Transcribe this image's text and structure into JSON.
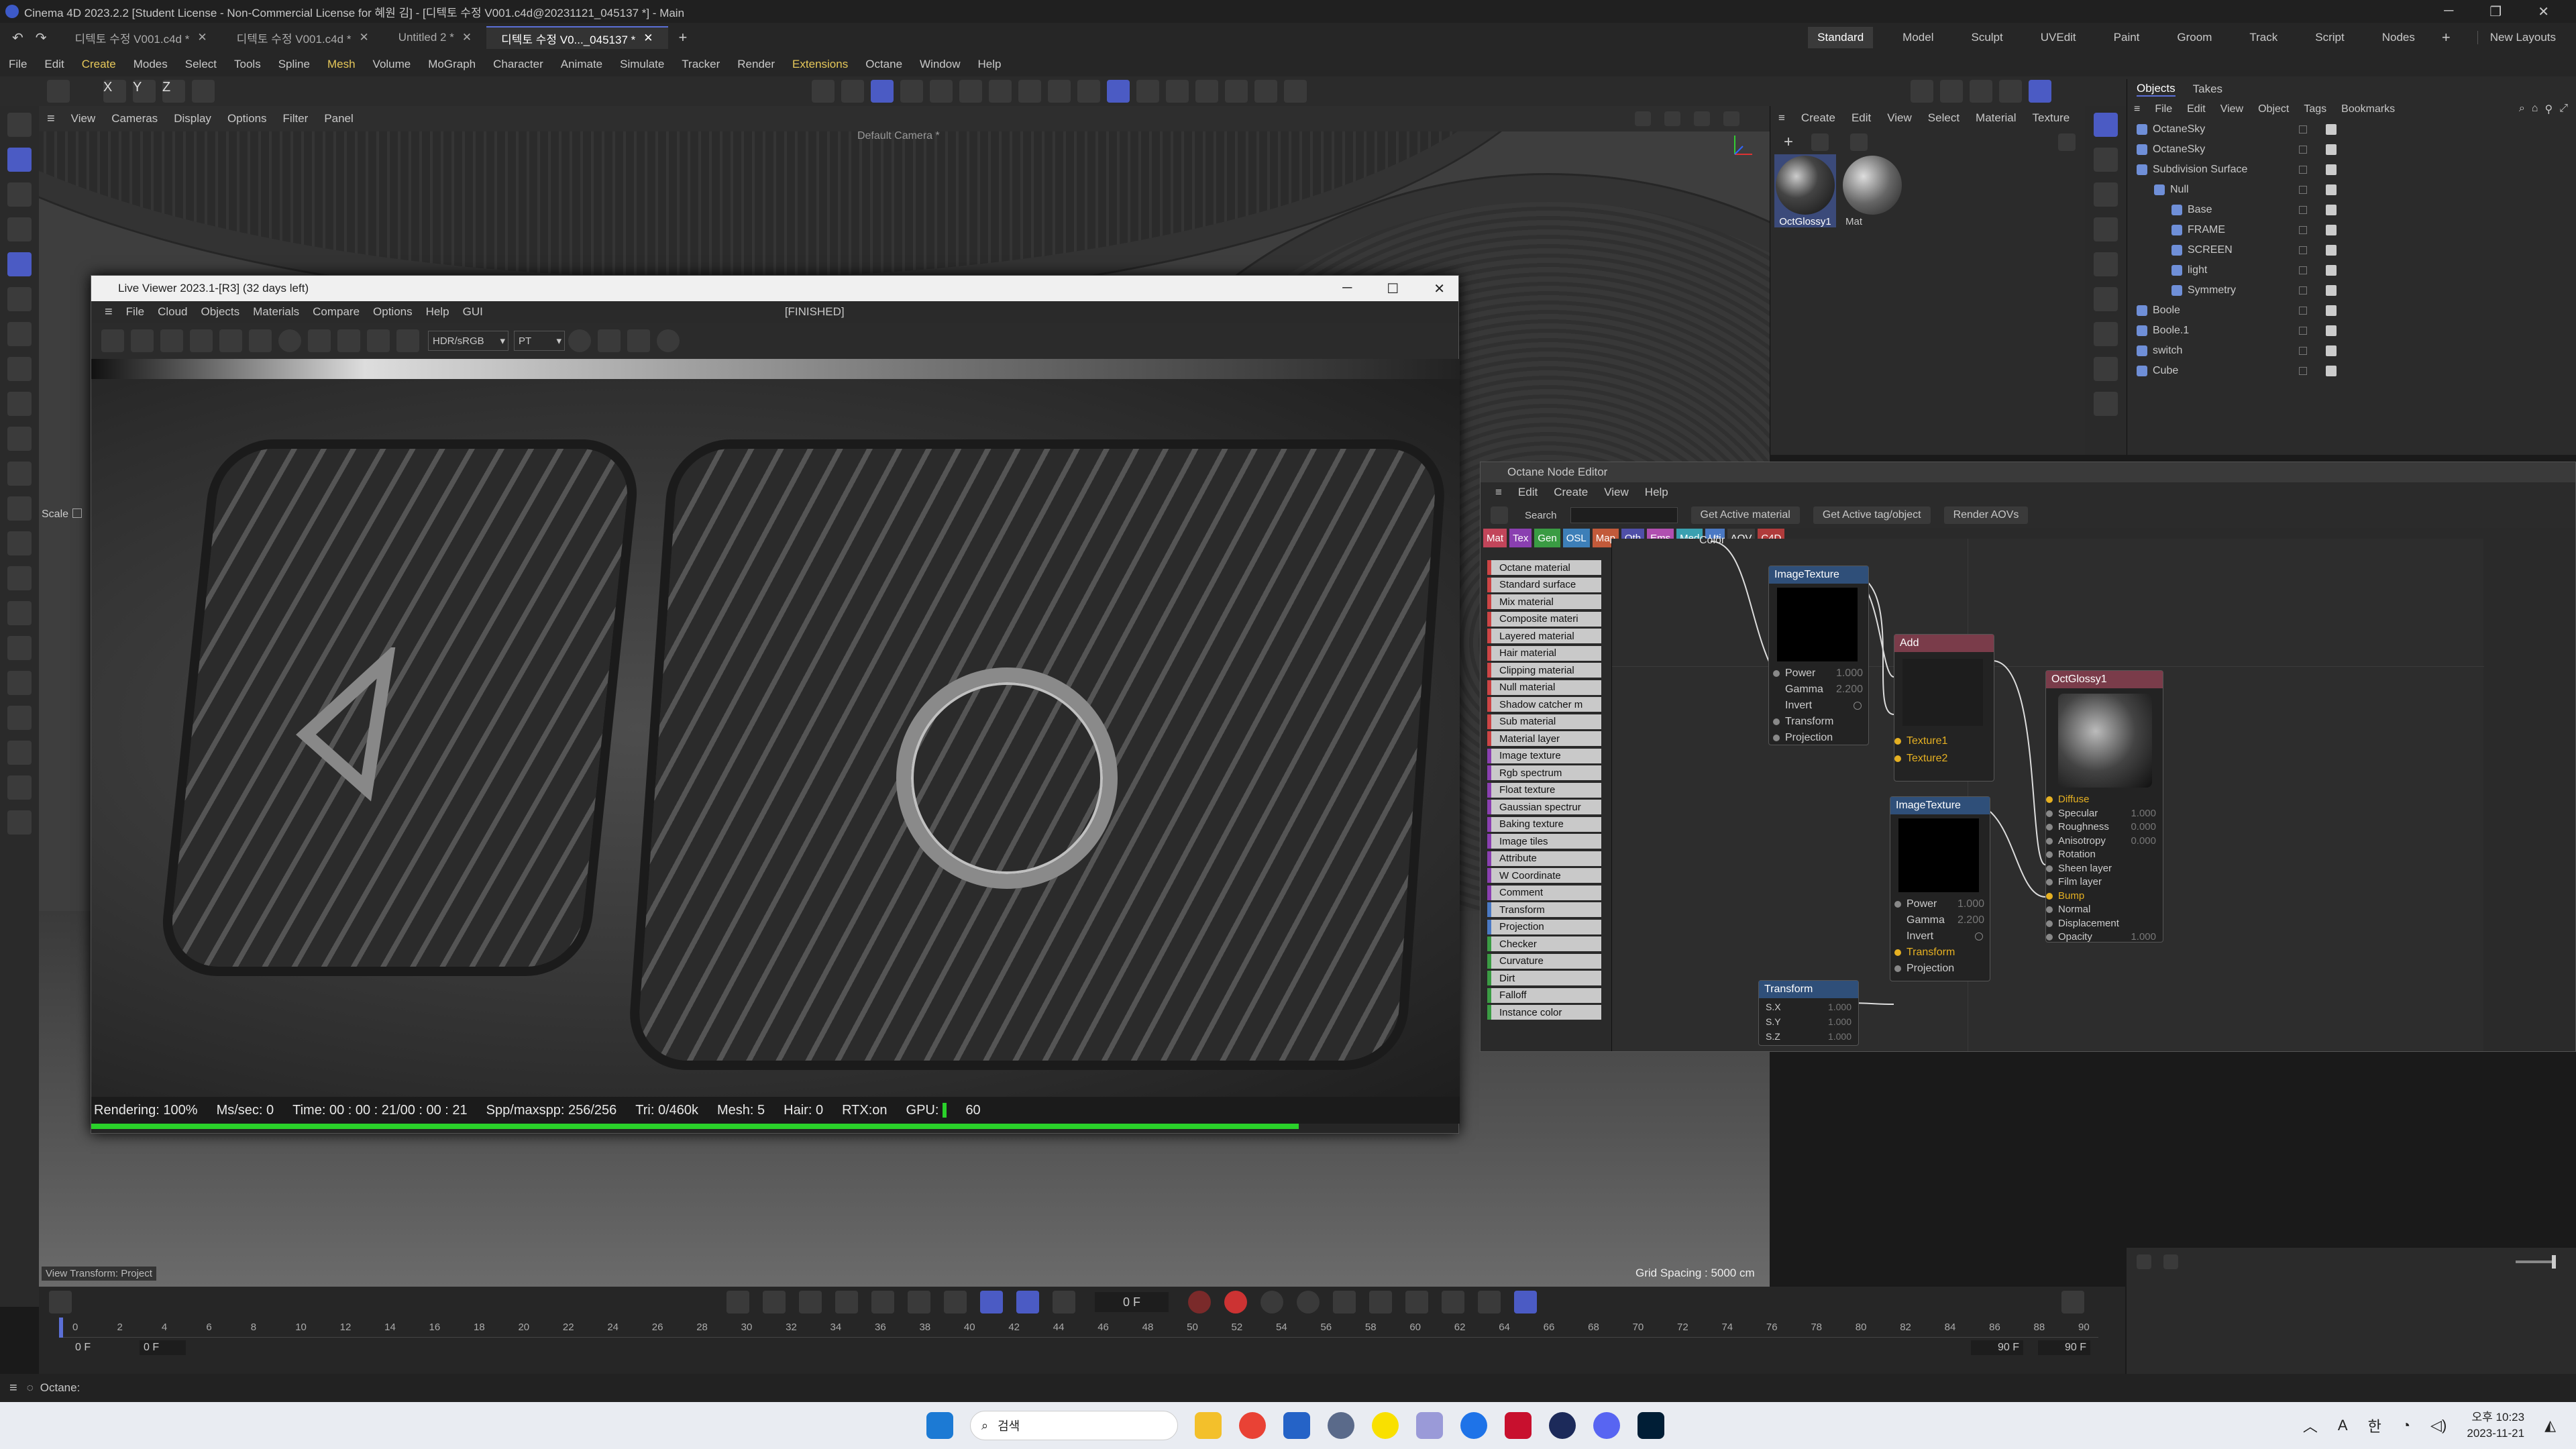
{
  "app": {
    "title": "Cinema 4D 2023.2.2 [Student License - Non-Commercial License for 혜원 김] - [디텍토 수정 V001.c4d@20231121_045137 *] - Main",
    "layouts": [
      "Standard",
      "Model",
      "Sculpt",
      "UVEdit",
      "Paint",
      "Groom",
      "Track",
      "Script",
      "Nodes"
    ],
    "new_layouts": "New Layouts"
  },
  "doc_tabs": [
    "디텍토 수정 V001.c4d *",
    "디텍토 수정 V001.c4d *",
    "Untitled 2 *",
    "디텍토 수정 V0..._045137 *"
  ],
  "menu": [
    "File",
    "Edit",
    "Create",
    "Modes",
    "Select",
    "Tools",
    "Spline",
    "Mesh",
    "Volume",
    "MoGraph",
    "Character",
    "Animate",
    "Simulate",
    "Tracker",
    "Render",
    "Extensions",
    "Octane",
    "Window",
    "Help"
  ],
  "axis": [
    "X",
    "Y",
    "Z"
  ],
  "viewport": {
    "menu": [
      "View",
      "Cameras",
      "Display",
      "Options",
      "Filter",
      "Panel"
    ],
    "camera": "Default Camera *",
    "scale_label": "Scale",
    "view_transform": "View Transform: Project",
    "grid_spacing": "Grid Spacing : 5000 cm"
  },
  "live_viewer": {
    "title": "Live Viewer 2023.1-[R3] (32 days left)",
    "menu": [
      "File",
      "Cloud",
      "Objects",
      "Materials",
      "Compare",
      "Options",
      "Help",
      "GUI"
    ],
    "state": "[FINISHED]",
    "color_mode": "HDR/sRGB",
    "kernel": "PT",
    "status": {
      "rendering": "Rendering: 100%",
      "ms": "Ms/sec: 0",
      "time": "Time: 00 : 00 : 21/00 : 00 : 21",
      "spp": "Spp/maxspp: 256/256",
      "tri": "Tri: 0/460k",
      "mesh": "Mesh: 5",
      "hair": "Hair: 0",
      "rtx": "RTX:on",
      "gpu": "GPU:",
      "gpu_val": "60"
    },
    "progress": 1.0
  },
  "material_panel": {
    "menu": [
      "Create",
      "Edit",
      "View",
      "Select",
      "Material",
      "Texture"
    ],
    "materials": [
      "OctGlossy1",
      "Mat"
    ]
  },
  "objects_panel": {
    "tabs": [
      "Objects",
      "Takes"
    ],
    "menu": [
      "File",
      "Edit",
      "View",
      "Object",
      "Tags",
      "Bookmarks"
    ],
    "items": [
      {
        "name": "OctaneSky",
        "depth": 0
      },
      {
        "name": "OctaneSky",
        "depth": 0
      },
      {
        "name": "Subdivision Surface",
        "depth": 0
      },
      {
        "name": "Null",
        "depth": 1
      },
      {
        "name": "Base",
        "depth": 2
      },
      {
        "name": "FRAME",
        "depth": 2
      },
      {
        "name": "SCREEN",
        "depth": 2
      },
      {
        "name": "light",
        "depth": 2
      },
      {
        "name": "Symmetry",
        "depth": 2
      },
      {
        "name": "Boole",
        "depth": 0
      },
      {
        "name": "Boole.1",
        "depth": 0
      },
      {
        "name": "switch",
        "depth": 0
      },
      {
        "name": "Cube",
        "depth": 0
      }
    ]
  },
  "node_editor": {
    "title": "Octane Node Editor",
    "menu": [
      "Edit",
      "Create",
      "View",
      "Help"
    ],
    "search": "Search",
    "buttons": [
      "Get Active material",
      "Get Active tag/object",
      "Render AOVs"
    ],
    "categories": [
      {
        "label": "Mat",
        "color": "#c2455a"
      },
      {
        "label": "Tex",
        "color": "#8a3fb0"
      },
      {
        "label": "Gen",
        "color": "#3a9b43"
      },
      {
        "label": "OSL",
        "color": "#3d7fb8"
      },
      {
        "label": "Map",
        "color": "#c25a3a"
      },
      {
        "label": "Oth",
        "color": "#4f4fa8"
      },
      {
        "label": "Ems",
        "color": "#b04fb0"
      },
      {
        "label": "Med",
        "color": "#3aa0b0"
      },
      {
        "label": "Uti",
        "color": "#4a79c4"
      },
      {
        "label": "AOV",
        "color": "#3b3b3b"
      },
      {
        "label": "C4D",
        "color": "#b03b3b"
      }
    ],
    "library": [
      "Octane material",
      "Standard surface",
      "Mix material",
      "Composite materi",
      "Layered material",
      "Hair material",
      "Clipping material",
      "Null material",
      "Shadow catcher m",
      "Sub material",
      "Material layer",
      "Image texture",
      "Rgb spectrum",
      "Float texture",
      "Gaussian spectrur",
      "Baking texture",
      "Image tiles",
      "Attribute",
      "W Coordinate",
      "Comment",
      "Transform",
      "Projection",
      "Checker",
      "Curvature",
      "Dirt",
      "Falloff",
      "Instance color"
    ],
    "color_label": "Color",
    "nodes": {
      "image1": {
        "title": "ImageTexture",
        "power": "Power",
        "power_v": "1.000",
        "gamma": "Gamma",
        "gamma_v": "2.200",
        "invert": "Invert",
        "transform": "Transform",
        "projection": "Projection"
      },
      "add": {
        "title": "Add",
        "t1": "Texture1",
        "t2": "Texture2"
      },
      "glossy": {
        "title": "OctGlossy1",
        "pins": [
          "Diffuse",
          "Specular",
          "Roughness",
          "Anisotropy",
          "Rotation",
          "Sheen layer",
          "Film layer",
          "Bump",
          "Normal",
          "Displacement",
          "Opacity"
        ],
        "vals": [
          "",
          "1.000",
          "0.000",
          "0.000",
          "",
          "",
          "",
          "",
          "",
          "",
          "1.000"
        ]
      },
      "image2": {
        "title": "ImageTexture",
        "power": "Power",
        "power_v": "1.000",
        "gamma": "Gamma",
        "gamma_v": "2.200",
        "invert": "Invert",
        "transform": "Transform",
        "projection": "Projection"
      },
      "transform": {
        "title": "Transform",
        "sx": "S.X",
        "sx_v": "1.000",
        "sy": "S.Y",
        "sy_v": "1.000",
        "sz": "S.Z",
        "sz_v": "1.000"
      }
    }
  },
  "timeline": {
    "frame": "0 F",
    "ticks": [
      "0",
      "2",
      "4",
      "6",
      "8",
      "10",
      "12",
      "14",
      "16",
      "18",
      "20",
      "22",
      "24",
      "26",
      "28",
      "30",
      "32",
      "34",
      "36",
      "38",
      "40",
      "42",
      "44",
      "46",
      "48",
      "50",
      "52",
      "54",
      "56",
      "58",
      "60",
      "62",
      "64",
      "66",
      "68",
      "70",
      "72",
      "74",
      "76",
      "78",
      "80",
      "82",
      "84",
      "86",
      "88",
      "90"
    ],
    "start": "0 F",
    "start2": "0 F",
    "end": "90 F",
    "end2": "90 F"
  },
  "status_bar": {
    "text": "Octane:"
  },
  "taskbar": {
    "search": "검색",
    "ime1": "A",
    "ime2": "한",
    "time": "오후 10:23",
    "date": "2023-11-21"
  }
}
